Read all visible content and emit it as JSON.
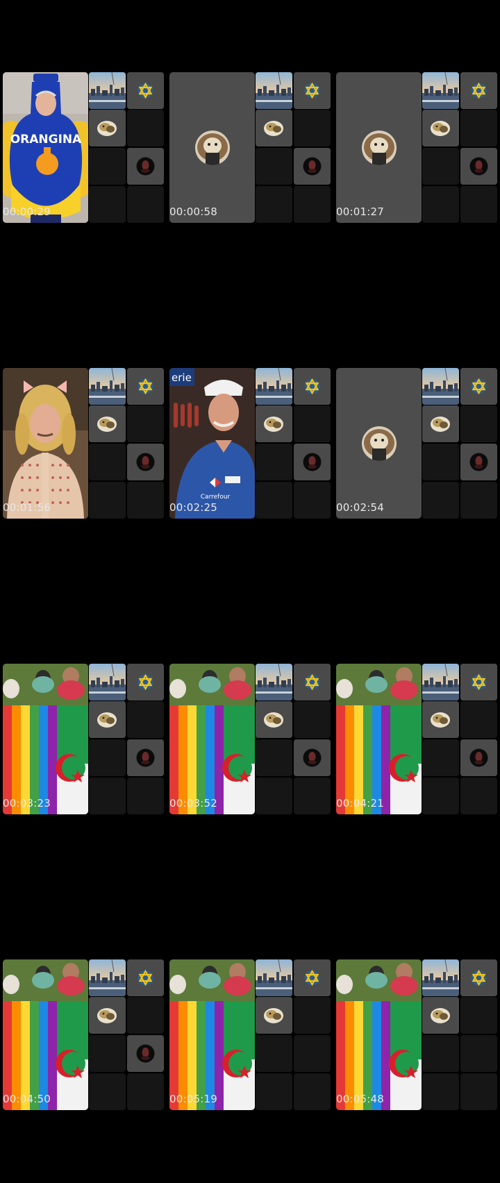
{
  "timestamps": [
    "00:00:29",
    "00:00:58",
    "00:01:27",
    "00:01:56",
    "00:02:25",
    "00:02:54",
    "00:03:23",
    "00:03:52",
    "00:04:21",
    "00:04:50",
    "00:05:19",
    "00:05:48"
  ],
  "frames": [
    {
      "main": "orangina",
      "bottom_dark": true
    },
    {
      "main": "empty",
      "bottom_dark": true
    },
    {
      "main": "empty",
      "bottom_dark": true
    },
    {
      "main": "doll",
      "bottom_dark": true
    },
    {
      "main": "carrefour",
      "bottom_dark": true
    },
    {
      "main": "empty",
      "bottom_dark": true
    },
    {
      "main": "flags",
      "bottom_dark": true
    },
    {
      "main": "flags",
      "bottom_dark": true
    },
    {
      "main": "flags",
      "bottom_dark": true
    },
    {
      "main": "flags",
      "bottom_dark": true
    },
    {
      "main": "flags",
      "bottom_dark": false
    },
    {
      "main": "flags",
      "bottom_dark": false
    }
  ],
  "image_text": {
    "orangina": "ORANGINA",
    "carrefour": "Carrefour",
    "shop_sign": "erie"
  },
  "icons": {
    "star": "star-of-david-icon",
    "city": "city-thumbnail",
    "head": "medallion-thumbnail",
    "dark": "dark-avatar-icon"
  },
  "colors": {
    "background": "#000000",
    "tile_lit": "#4a4a4a",
    "tile_dark": "#161616",
    "timestamp": "#e8e8e8"
  }
}
